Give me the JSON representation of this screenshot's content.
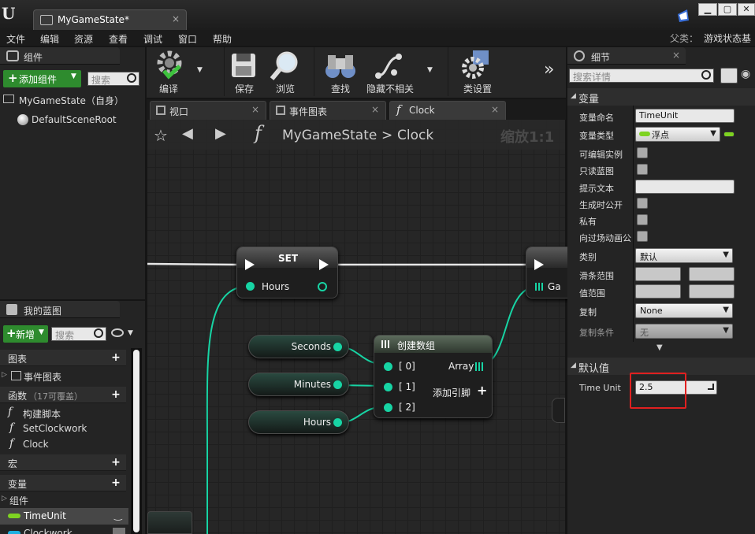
{
  "window": {
    "tab_title": "MyGameState*",
    "tab_close": "×",
    "logo": "U"
  },
  "menu": [
    "文件",
    "编辑",
    "资源",
    "查看",
    "调试",
    "窗口",
    "帮助"
  ],
  "parent": {
    "label": "父类：",
    "value": "游戏状态基"
  },
  "components": {
    "title": "组件",
    "add_button": "添加组件",
    "search_placeholder": "搜索",
    "root_item": "MyGameState（自身）",
    "child_item": "DefaultSceneRoot"
  },
  "my_blueprint": {
    "title": "我的蓝图",
    "new_button": "新增",
    "search_placeholder": "搜索",
    "sections": {
      "graphs": "图表",
      "event_graph": "事件图表",
      "functions": "函数",
      "functions_note": "（17可覆盖）",
      "construction": "构建脚本",
      "fn1": "SetClockwork",
      "fn2": "Clock",
      "macros": "宏",
      "variables": "变量",
      "components": "组件",
      "var1": "TimeUnit",
      "var2": "Clockwork"
    }
  },
  "toolbar": {
    "compile": "编译",
    "save": "保存",
    "browse": "浏览",
    "find": "查找",
    "hide_unrelated": "隐藏不相关",
    "class_settings": "类设置",
    "overflow": "»"
  },
  "graph_tabs": {
    "viewport": "视口",
    "event_graph": "事件图表",
    "clock": "Clock"
  },
  "graph": {
    "breadcrumb_root": "MyGameState",
    "breadcrumb_sep": ">",
    "breadcrumb_leaf": "Clock",
    "zoom": "缩放1:1",
    "set_node": {
      "title": "SET",
      "pin": "Hours"
    },
    "make_array": {
      "title": "创建数组",
      "pin0": "[ 0]",
      "pin1": "[ 1]",
      "pin2": "[ 2]",
      "out": "Array",
      "add_pin": "添加引脚"
    },
    "var_nodes": [
      "Seconds",
      "Minutes",
      "Hours"
    ],
    "partial_node": "Ga"
  },
  "details": {
    "title": "细节",
    "search_placeholder": "搜索详情",
    "variable_section": "变量",
    "rows": {
      "name_label": "变量命名",
      "name_value": "TimeUnit",
      "type_label": "变量类型",
      "type_value": "浮点",
      "editable_label": "可编辑实例",
      "readonly_label": "只读蓝图",
      "tooltip_label": "提示文本",
      "expose_label": "生成时公开",
      "private_label": "私有",
      "cinematic_label": "向过场动画公",
      "category_label": "类别",
      "category_value": "默认",
      "slider_label": "滑条范围",
      "value_label": "值范围",
      "replication_label": "复制",
      "replication_value": "None",
      "repcond_label": "复制条件",
      "repcond_value": "无"
    },
    "default_section": "默认值",
    "default_label": "Time Unit",
    "default_value": "2.5"
  },
  "colors": {
    "accent_green": "#2e8b2e",
    "float_pin": "#17d4a4",
    "highlight": "#e02020"
  }
}
